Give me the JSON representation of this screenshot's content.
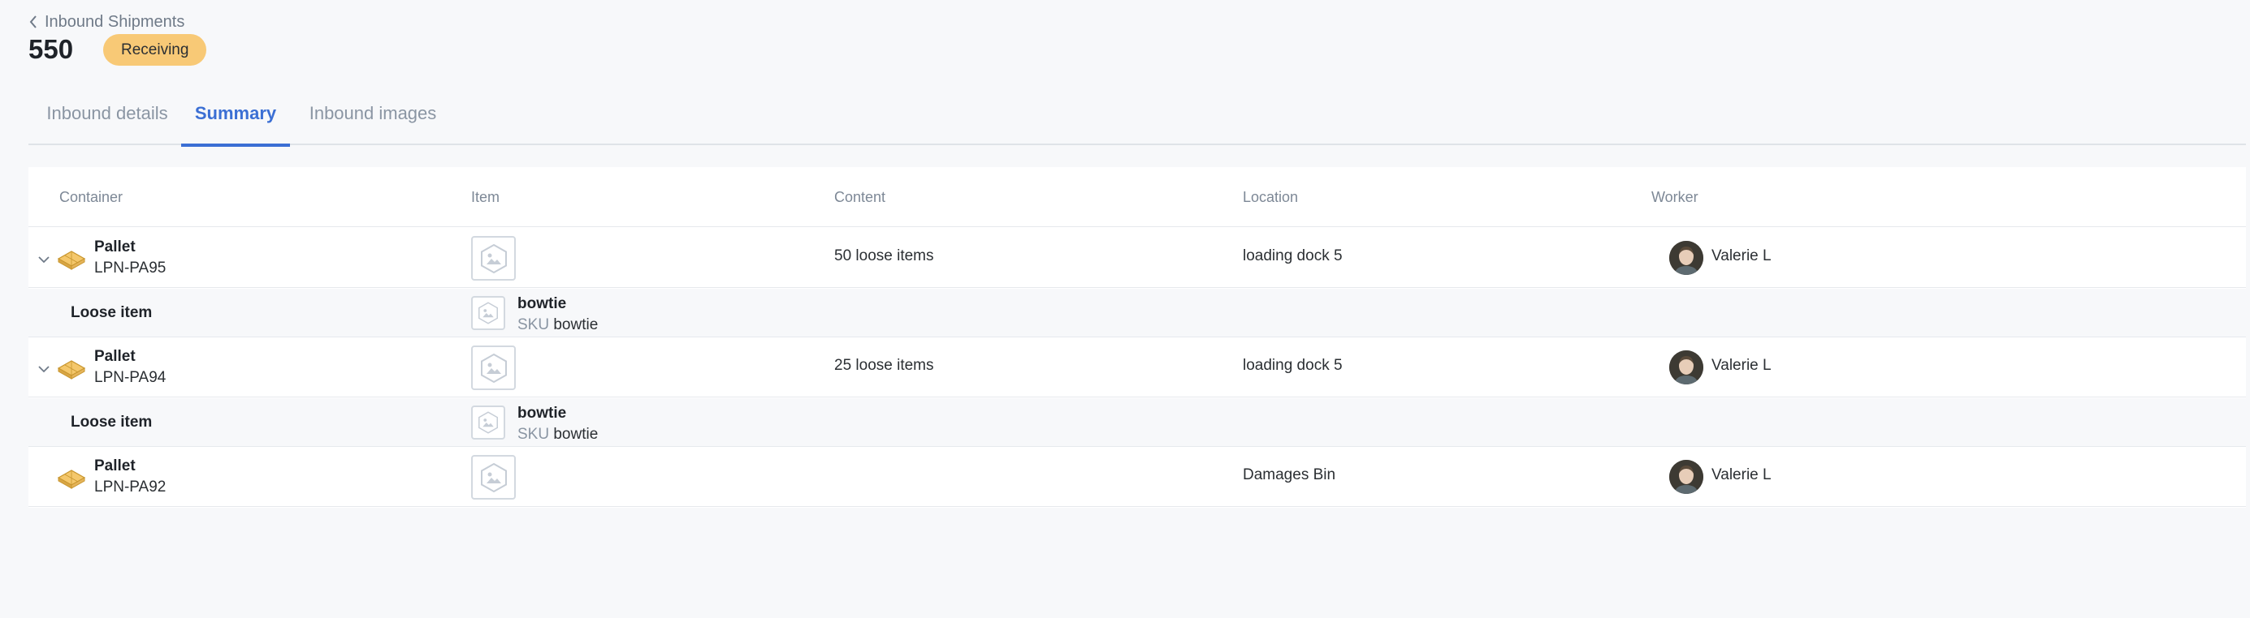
{
  "header": {
    "back_label": "Inbound Shipments",
    "title": "550",
    "status": "Receiving",
    "status_color": "#f8c976"
  },
  "tabs": [
    {
      "label": "Inbound details",
      "active": false
    },
    {
      "label": "Summary",
      "active": true
    },
    {
      "label": "Inbound images",
      "active": false
    }
  ],
  "accent_color": "#3b6fd4",
  "table": {
    "columns": [
      "Container",
      "Item",
      "Content",
      "Location",
      "Worker"
    ],
    "rows": [
      {
        "type": "Pallet",
        "id": "LPN-PA95",
        "content": "50 loose items",
        "location": "loading dock 5",
        "worker": "Valerie L",
        "child": {
          "type": "Loose item",
          "item_name": "bowtie",
          "sku_label": "SKU",
          "sku": "bowtie"
        }
      },
      {
        "type": "Pallet",
        "id": "LPN-PA94",
        "content": "25 loose items",
        "location": "loading dock 5",
        "worker": "Valerie L",
        "child": {
          "type": "Loose item",
          "item_name": "bowtie",
          "sku_label": "SKU",
          "sku": "bowtie"
        }
      },
      {
        "type": "Pallet",
        "id": "LPN-PA92",
        "content": "",
        "location": "Damages Bin",
        "worker": "Valerie L"
      }
    ]
  },
  "icons": {
    "back": "chevron-left-icon",
    "expand": "chevron-down-icon",
    "pallet": "pallet-icon",
    "placeholder": "image-placeholder-icon"
  }
}
